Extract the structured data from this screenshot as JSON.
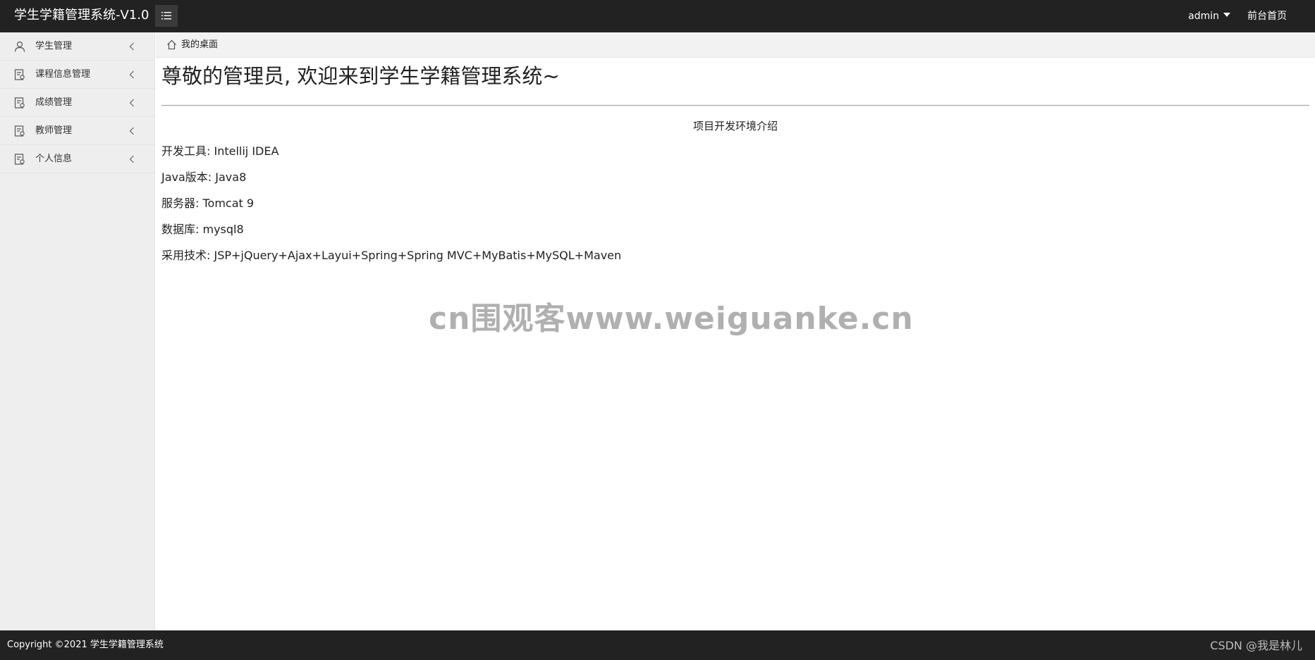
{
  "header": {
    "logo": "学生学籍管理系统-V1.0",
    "menu_toggle_icon": "list-icon",
    "user": "admin",
    "front_link": "前台首页"
  },
  "sidebar": {
    "items": [
      {
        "label": "学生管理",
        "icon": "user-icon"
      },
      {
        "label": "课程信息管理",
        "icon": "document-icon"
      },
      {
        "label": "成绩管理",
        "icon": "document-icon"
      },
      {
        "label": "教师管理",
        "icon": "document-icon"
      },
      {
        "label": "个人信息",
        "icon": "document-icon"
      }
    ]
  },
  "breadcrumb": {
    "icon": "home-icon",
    "label": "我的桌面"
  },
  "main": {
    "welcome": "尊敬的管理员, 欢迎来到学生学籍管理系统~",
    "intro_title": "项目开发环境介绍",
    "lines": [
      "开发工具: Intellij IDEA",
      "Java版本: Java8",
      "服务器: Tomcat 9",
      "数据库: mysql8",
      "采用技术: JSP+jQuery+Ajax+Layui+Spring+Spring MVC+MyBatis+MySQL+Maven"
    ]
  },
  "watermark": "cn围观客www.weiguanke.cn",
  "footer": {
    "copyright": "Copyright ©2021 学生学籍管理系统",
    "csdn": "CSDN @我是林儿"
  },
  "colors": {
    "header_bg": "#222222",
    "sidebar_bg": "#eeeeee",
    "breadcrumb_bg": "#f2f2f2"
  }
}
